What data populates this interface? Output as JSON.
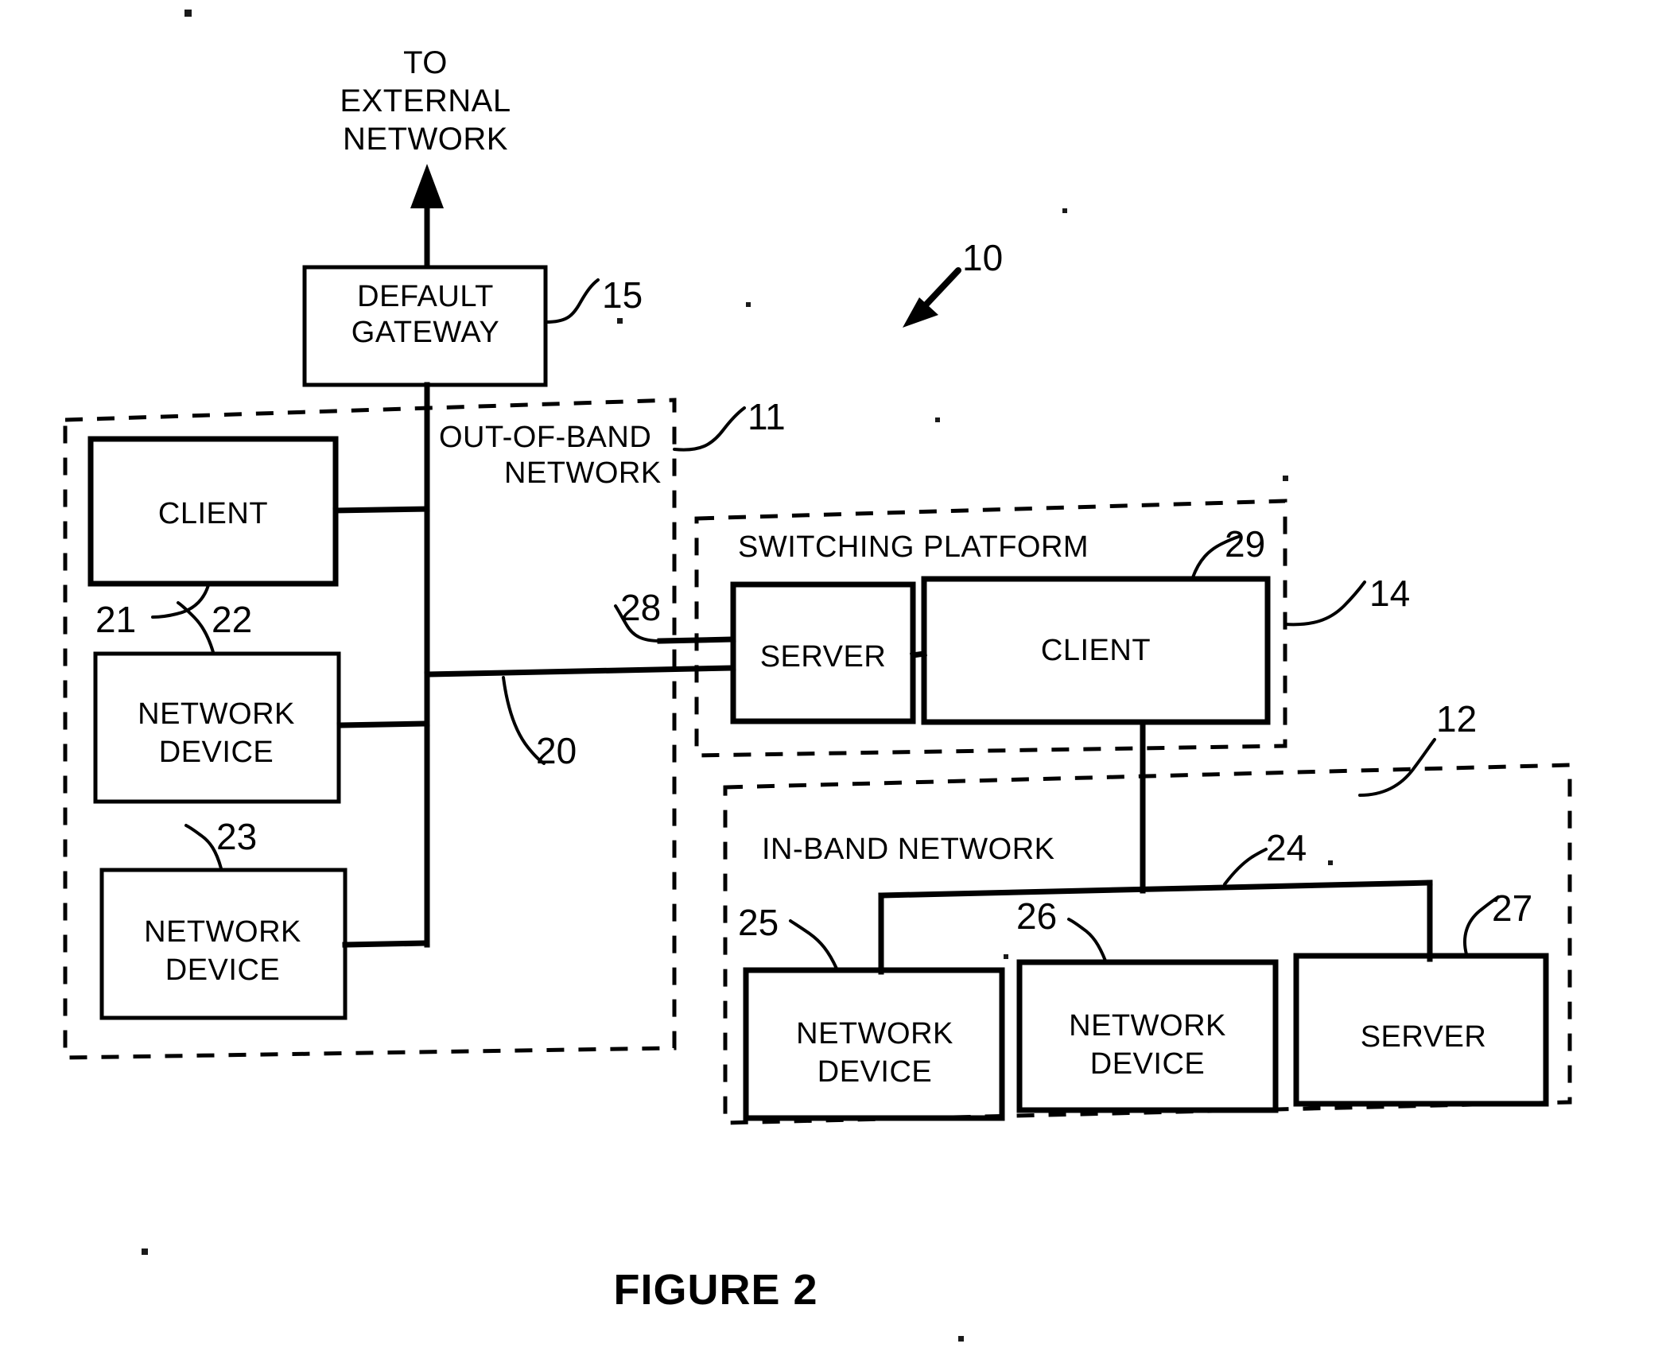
{
  "figure": {
    "caption": "FIGURE 2",
    "system_ref": "10"
  },
  "external": {
    "line1": "TO",
    "line2": "EXTERNAL",
    "line3": "NETWORK",
    "arrow_icon": "up-arrow-icon"
  },
  "gateway": {
    "line1": "DEFAULT",
    "line2": "GATEWAY",
    "ref": "15"
  },
  "oob_network": {
    "line1": "OUT-OF-BAND",
    "line2": "NETWORK",
    "ref": "11",
    "bus_ref": "20",
    "nodes": [
      {
        "label_line1": "CLIENT",
        "label_line2": "",
        "ref": "21"
      },
      {
        "label_line1": "NETWORK",
        "label_line2": "DEVICE",
        "ref": "22"
      },
      {
        "label_line1": "NETWORK",
        "label_line2": "DEVICE",
        "ref": "23"
      }
    ]
  },
  "switching_platform": {
    "title": "SWITCHING PLATFORM",
    "ref": "14",
    "link_ref": "28",
    "nodes": [
      {
        "label": "SERVER",
        "ref": ""
      },
      {
        "label": "CLIENT",
        "ref": "29"
      }
    ]
  },
  "inband_network": {
    "title": "IN-BAND NETWORK",
    "ref": "12",
    "bus_ref": "24",
    "nodes": [
      {
        "label_line1": "NETWORK",
        "label_line2": "DEVICE",
        "ref": "25"
      },
      {
        "label_line1": "NETWORK",
        "label_line2": "DEVICE",
        "ref": "26"
      },
      {
        "label_line1": "SERVER",
        "label_line2": "",
        "ref": "27"
      }
    ]
  },
  "colors": {
    "ink": "#000000",
    "paper": "#ffffff"
  }
}
